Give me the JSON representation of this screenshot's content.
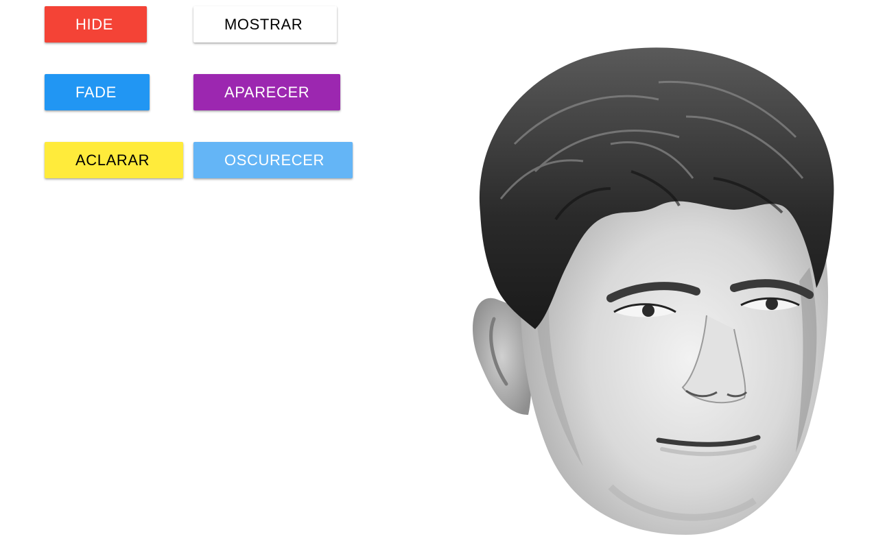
{
  "buttons": {
    "hide": {
      "label": "HIDE",
      "color": "#f44336"
    },
    "mostrar": {
      "label": "MOSTRAR",
      "color": "#ffffff"
    },
    "fade": {
      "label": "FADE",
      "color": "#2196f3"
    },
    "aparecer": {
      "label": "APARECER",
      "color": "#9c27b0"
    },
    "aclarar": {
      "label": "ACLARAR",
      "color": "#ffeb3b"
    },
    "oscurecer": {
      "label": "OSCURECER",
      "color": "#64b5f6"
    }
  },
  "image": {
    "subject": "grayscale-face-photo"
  }
}
